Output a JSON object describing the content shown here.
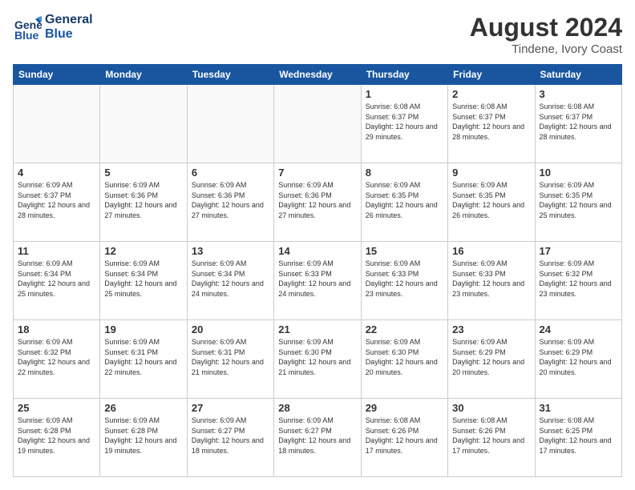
{
  "header": {
    "logo_line1": "General",
    "logo_line2": "Blue",
    "month_year": "August 2024",
    "location": "Tindene, Ivory Coast"
  },
  "weekdays": [
    "Sunday",
    "Monday",
    "Tuesday",
    "Wednesday",
    "Thursday",
    "Friday",
    "Saturday"
  ],
  "weeks": [
    [
      {
        "day": "",
        "detail": ""
      },
      {
        "day": "",
        "detail": ""
      },
      {
        "day": "",
        "detail": ""
      },
      {
        "day": "",
        "detail": ""
      },
      {
        "day": "1",
        "detail": "Sunrise: 6:08 AM\nSunset: 6:37 PM\nDaylight: 12 hours\nand 29 minutes."
      },
      {
        "day": "2",
        "detail": "Sunrise: 6:08 AM\nSunset: 6:37 PM\nDaylight: 12 hours\nand 28 minutes."
      },
      {
        "day": "3",
        "detail": "Sunrise: 6:08 AM\nSunset: 6:37 PM\nDaylight: 12 hours\nand 28 minutes."
      }
    ],
    [
      {
        "day": "4",
        "detail": "Sunrise: 6:09 AM\nSunset: 6:37 PM\nDaylight: 12 hours\nand 28 minutes."
      },
      {
        "day": "5",
        "detail": "Sunrise: 6:09 AM\nSunset: 6:36 PM\nDaylight: 12 hours\nand 27 minutes."
      },
      {
        "day": "6",
        "detail": "Sunrise: 6:09 AM\nSunset: 6:36 PM\nDaylight: 12 hours\nand 27 minutes."
      },
      {
        "day": "7",
        "detail": "Sunrise: 6:09 AM\nSunset: 6:36 PM\nDaylight: 12 hours\nand 27 minutes."
      },
      {
        "day": "8",
        "detail": "Sunrise: 6:09 AM\nSunset: 6:35 PM\nDaylight: 12 hours\nand 26 minutes."
      },
      {
        "day": "9",
        "detail": "Sunrise: 6:09 AM\nSunset: 6:35 PM\nDaylight: 12 hours\nand 26 minutes."
      },
      {
        "day": "10",
        "detail": "Sunrise: 6:09 AM\nSunset: 6:35 PM\nDaylight: 12 hours\nand 25 minutes."
      }
    ],
    [
      {
        "day": "11",
        "detail": "Sunrise: 6:09 AM\nSunset: 6:34 PM\nDaylight: 12 hours\nand 25 minutes."
      },
      {
        "day": "12",
        "detail": "Sunrise: 6:09 AM\nSunset: 6:34 PM\nDaylight: 12 hours\nand 25 minutes."
      },
      {
        "day": "13",
        "detail": "Sunrise: 6:09 AM\nSunset: 6:34 PM\nDaylight: 12 hours\nand 24 minutes."
      },
      {
        "day": "14",
        "detail": "Sunrise: 6:09 AM\nSunset: 6:33 PM\nDaylight: 12 hours\nand 24 minutes."
      },
      {
        "day": "15",
        "detail": "Sunrise: 6:09 AM\nSunset: 6:33 PM\nDaylight: 12 hours\nand 23 minutes."
      },
      {
        "day": "16",
        "detail": "Sunrise: 6:09 AM\nSunset: 6:33 PM\nDaylight: 12 hours\nand 23 minutes."
      },
      {
        "day": "17",
        "detail": "Sunrise: 6:09 AM\nSunset: 6:32 PM\nDaylight: 12 hours\nand 23 minutes."
      }
    ],
    [
      {
        "day": "18",
        "detail": "Sunrise: 6:09 AM\nSunset: 6:32 PM\nDaylight: 12 hours\nand 22 minutes."
      },
      {
        "day": "19",
        "detail": "Sunrise: 6:09 AM\nSunset: 6:31 PM\nDaylight: 12 hours\nand 22 minutes."
      },
      {
        "day": "20",
        "detail": "Sunrise: 6:09 AM\nSunset: 6:31 PM\nDaylight: 12 hours\nand 21 minutes."
      },
      {
        "day": "21",
        "detail": "Sunrise: 6:09 AM\nSunset: 6:30 PM\nDaylight: 12 hours\nand 21 minutes."
      },
      {
        "day": "22",
        "detail": "Sunrise: 6:09 AM\nSunset: 6:30 PM\nDaylight: 12 hours\nand 20 minutes."
      },
      {
        "day": "23",
        "detail": "Sunrise: 6:09 AM\nSunset: 6:29 PM\nDaylight: 12 hours\nand 20 minutes."
      },
      {
        "day": "24",
        "detail": "Sunrise: 6:09 AM\nSunset: 6:29 PM\nDaylight: 12 hours\nand 20 minutes."
      }
    ],
    [
      {
        "day": "25",
        "detail": "Sunrise: 6:09 AM\nSunset: 6:28 PM\nDaylight: 12 hours\nand 19 minutes."
      },
      {
        "day": "26",
        "detail": "Sunrise: 6:09 AM\nSunset: 6:28 PM\nDaylight: 12 hours\nand 19 minutes."
      },
      {
        "day": "27",
        "detail": "Sunrise: 6:09 AM\nSunset: 6:27 PM\nDaylight: 12 hours\nand 18 minutes."
      },
      {
        "day": "28",
        "detail": "Sunrise: 6:09 AM\nSunset: 6:27 PM\nDaylight: 12 hours\nand 18 minutes."
      },
      {
        "day": "29",
        "detail": "Sunrise: 6:08 AM\nSunset: 6:26 PM\nDaylight: 12 hours\nand 17 minutes."
      },
      {
        "day": "30",
        "detail": "Sunrise: 6:08 AM\nSunset: 6:26 PM\nDaylight: 12 hours\nand 17 minutes."
      },
      {
        "day": "31",
        "detail": "Sunrise: 6:08 AM\nSunset: 6:25 PM\nDaylight: 12 hours\nand 17 minutes."
      }
    ]
  ]
}
